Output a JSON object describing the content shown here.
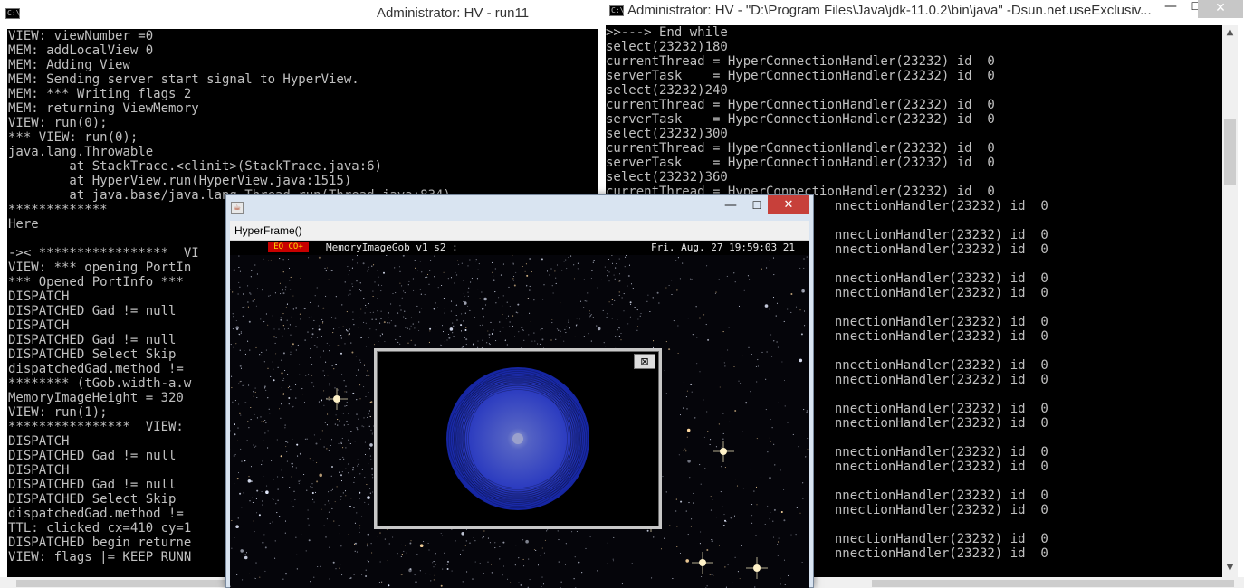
{
  "left_console": {
    "title": "Administrator: HV - run11",
    "icon_text": "C:\\",
    "lines": [
      "VIEW: viewNumber =0",
      "MEM: addLocalView 0",
      "MEM: Adding View",
      "MEM: Sending server start signal to HyperView.",
      "MEM: *** Writing flags 2",
      "MEM: returning ViewMemory",
      "VIEW: run(0);",
      "*** VIEW: run(0);",
      "java.lang.Throwable",
      "        at StackTrace.<clinit>(StackTrace.java:6)",
      "        at HyperView.run(HyperView.java:1515)",
      "        at java.base/java.lang.Thread.run(Thread.java:834)",
      "*************",
      "Here",
      "",
      "->< *****************  VI",
      "VIEW: *** opening PortIn",
      "*** Opened PortInfo ***",
      "DISPATCH",
      "DISPATCHED Gad != null",
      "DISPATCH",
      "DISPATCHED Gad != null",
      "DISPATCHED Select Skip",
      "dispatchedGad.method !=",
      "******** (tGob.width-a.w",
      "MemoryImageHeight = 320",
      "VIEW: run(1);",
      "****************  VIEW:",
      "DISPATCH",
      "DISPATCHED Gad != null",
      "DISPATCH",
      "DISPATCHED Gad != null",
      "DISPATCHED Select Skip",
      "dispatchedGad.method !=",
      "TTL: clicked cx=410 cy=1",
      "DISPATCHED begin returne",
      "VIEW: flags |= KEEP_RUNN"
    ]
  },
  "right_console": {
    "title": "Administrator: HV - \"D:\\Program Files\\Java\\jdk-11.0.2\\bin\\java\"  -Dsun.net.useExclusiv...",
    "icon_text": "C:\\",
    "controls": {
      "minimize": "—",
      "maximize": "☐",
      "close": "✕"
    },
    "lines": [
      ">>---> End while",
      "select(23232)180",
      "currentThread = HyperConnectionHandler(23232) id  0",
      "serverTask    = HyperConnectionHandler(23232) id  0",
      "select(23232)240",
      "currentThread = HyperConnectionHandler(23232) id  0",
      "serverTask    = HyperConnectionHandler(23232) id  0",
      "select(23232)300",
      "currentThread = HyperConnectionHandler(23232) id  0",
      "serverTask    = HyperConnectionHandler(23232) id  0",
      "select(23232)360",
      "currentThread = HyperConnectionHandler(23232) id  0",
      "                              nnectionHandler(23232) id  0",
      "",
      "                              nnectionHandler(23232) id  0",
      "                              nnectionHandler(23232) id  0",
      "",
      "                              nnectionHandler(23232) id  0",
      "                              nnectionHandler(23232) id  0",
      "",
      "                              nnectionHandler(23232) id  0",
      "                              nnectionHandler(23232) id  0",
      "",
      "                              nnectionHandler(23232) id  0",
      "                              nnectionHandler(23232) id  0",
      "",
      "                              nnectionHandler(23232) id  0",
      "                              nnectionHandler(23232) id  0",
      "",
      "                              nnectionHandler(23232) id  0",
      "                              nnectionHandler(23232) id  0",
      "",
      "                              nnectionHandler(23232) id  0",
      "                              nnectionHandler(23232) id  0",
      "",
      "                              nnectionHandler(23232) id  0",
      "                              nnectionHandler(23232) id  0"
    ],
    "scroll_up_icon": "up-arrow-icon",
    "scroll_down_icon": "down-arrow-icon"
  },
  "hyperframe": {
    "title": "",
    "menu_label": "HyperFrame()",
    "controls": {
      "minimize": "—",
      "maximize": "☐",
      "close": "✕"
    },
    "status": {
      "badge": "EQ CO+",
      "title": "MemoryImageGob v1 s2 :",
      "datetime": "Fri. Aug. 27 19:59:03 21"
    },
    "gob_close": "⊠",
    "colors": {
      "sphere_center": "#7f8fd6",
      "sphere_edge": "#1a2aa8",
      "close_button": "#c7403a",
      "badge_bg": "#c80000",
      "badge_fg": "#ffd800"
    }
  }
}
